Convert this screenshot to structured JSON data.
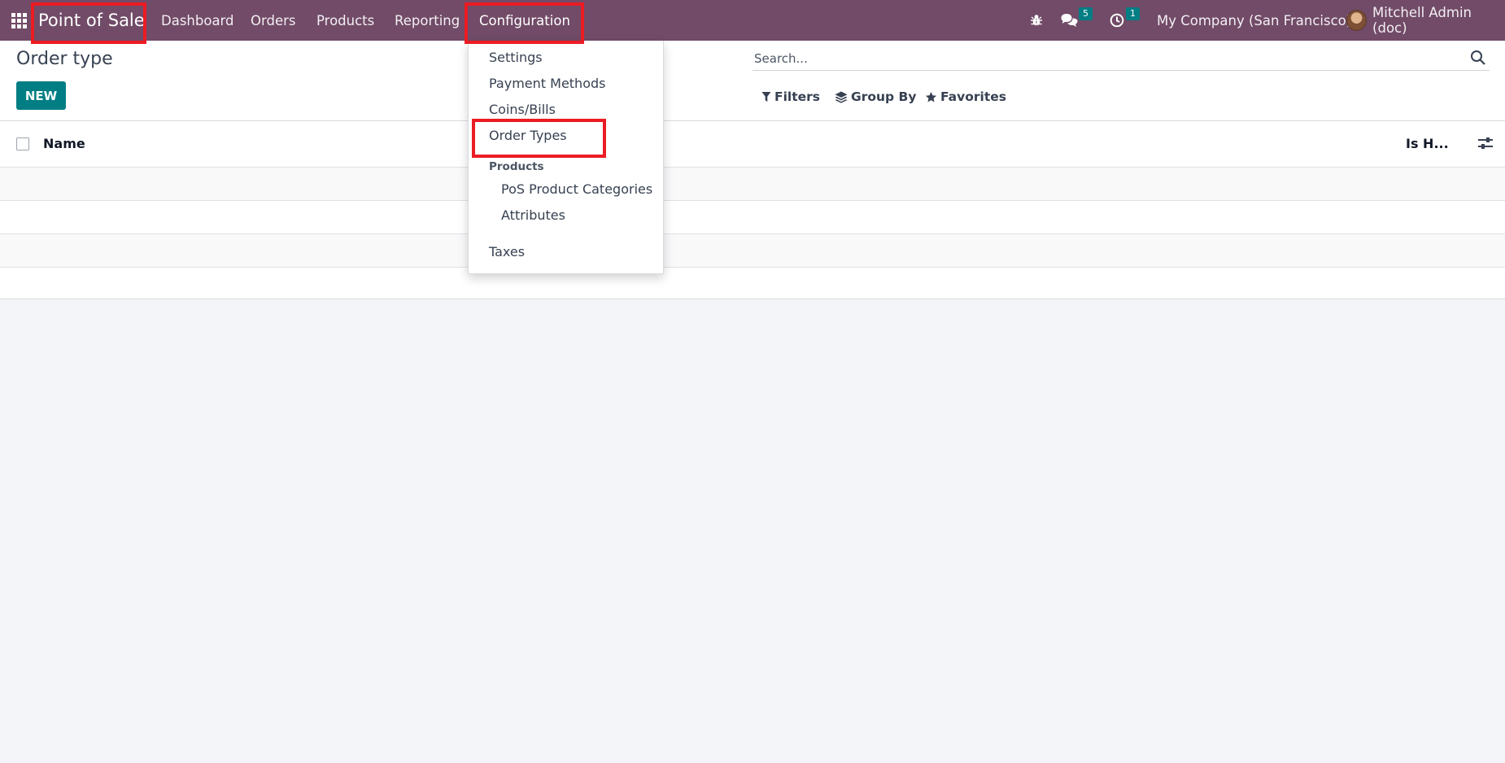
{
  "navbar": {
    "brand": "Point of Sale",
    "menu": [
      "Dashboard",
      "Orders",
      "Products",
      "Reporting",
      "Configuration"
    ],
    "messages_count": "5",
    "activities_count": "1",
    "company": "My Company (San Francisco)",
    "user": "Mitchell Admin (doc)"
  },
  "page": {
    "title": "Order type",
    "new_button": "NEW"
  },
  "search": {
    "placeholder": "Search...",
    "filters": "Filters",
    "group_by": "Group By",
    "favorites": "Favorites"
  },
  "list": {
    "columns": [
      "Name",
      "Is H..."
    ]
  },
  "configuration_menu": {
    "items": [
      "Settings",
      "Payment Methods",
      "Coins/Bills",
      "Order Types"
    ],
    "products_header": "Products",
    "product_items": [
      "PoS Product Categories",
      "Attributes"
    ],
    "taxes": "Taxes"
  },
  "colors": {
    "navbar": "#714b67",
    "accent": "#017e84",
    "highlight": "#ec1c24"
  }
}
